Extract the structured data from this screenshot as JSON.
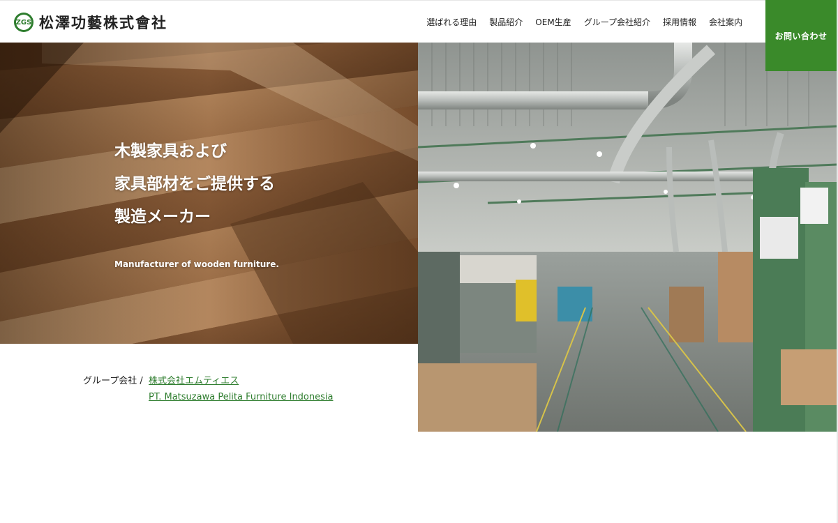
{
  "header": {
    "logo_text": "松澤功藝株式會社",
    "logo_mark": "ZGS",
    "nav": [
      {
        "label": "選ばれる理由"
      },
      {
        "label": "製品紹介"
      },
      {
        "label": "OEM生産"
      },
      {
        "label": "グループ会社紹介"
      },
      {
        "label": "採用情報"
      },
      {
        "label": "会社案内"
      }
    ],
    "contact_label": "お問い合わせ",
    "accent_color": "#3a8a2a"
  },
  "hero": {
    "title_lines": [
      "木製家具および",
      "家具部材をご提供する",
      "製造メーカー"
    ],
    "subtitle": "Manufacturer of wooden furniture."
  },
  "group": {
    "label": "グループ会社 /",
    "links": [
      {
        "label": "株式会社エムティエス"
      },
      {
        "label": "PT. Matsuzawa Pelita Furniture Indonesia"
      }
    ]
  },
  "images": {
    "left": "wood-planks-image",
    "right": "factory-floor-image"
  }
}
